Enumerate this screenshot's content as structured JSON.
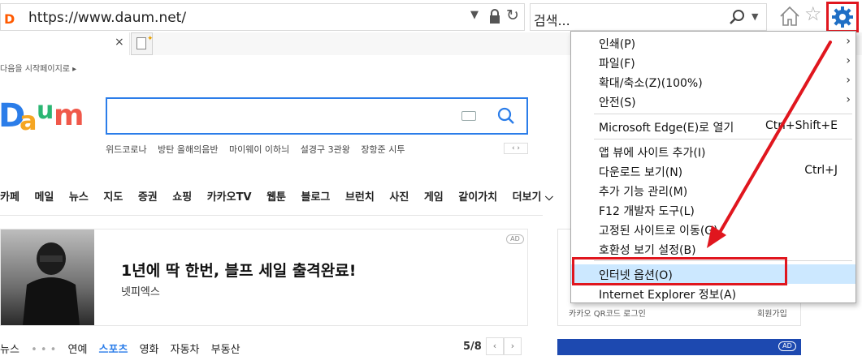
{
  "browser": {
    "url": "https://www.daum.net/",
    "search_placeholder": "검색...",
    "tab_close": "×"
  },
  "page": {
    "start_link": "다음을 시작페이지로 ▸",
    "trends": [
      "위드코로나",
      "방탄 올해의음반",
      "마이웨이 이하늬",
      "설경구 3관왕",
      "장항준 시투"
    ],
    "trend_nav": "‹ ›",
    "gnb": [
      "카페",
      "메일",
      "뉴스",
      "지도",
      "증권",
      "쇼핑",
      "카카오TV",
      "웹툰",
      "블로그",
      "브런치",
      "사진",
      "게임",
      "같이가치",
      "더보기 ⌵"
    ],
    "banner": {
      "title": "1년에 딱 한번, 블프 세일 출격완료!",
      "subtitle": "넷피엑스",
      "ad": "AD"
    },
    "news_tabs": [
      "뉴스",
      "연예",
      "스포츠",
      "영화",
      "자동차",
      "부동산"
    ],
    "news_dots": "• • •",
    "news_page": "5/8",
    "news_prev": "‹",
    "news_next": "›",
    "login_qr": "카카오 QR코드 로그인",
    "login_join": "회원가입",
    "right_ad": "AD"
  },
  "menu": {
    "items": [
      {
        "label": "인쇄(P)",
        "shortcut": "",
        "submenu": true
      },
      {
        "label": "파일(F)",
        "shortcut": "",
        "submenu": true
      },
      {
        "label": "확대/축소(Z)(100%)",
        "shortcut": "",
        "submenu": true
      },
      {
        "label": "안전(S)",
        "shortcut": "",
        "submenu": true
      },
      {
        "label": "Microsoft Edge(E)로 열기",
        "shortcut": "Ctrl+Shift+E",
        "submenu": false
      },
      {
        "label": "앱 뷰에 사이트 추가(I)",
        "shortcut": "",
        "submenu": false
      },
      {
        "label": "다운로드 보기(N)",
        "shortcut": "Ctrl+J",
        "submenu": false
      },
      {
        "label": "추가 기능 관리(M)",
        "shortcut": "",
        "submenu": false
      },
      {
        "label": "F12 개발자 도구(L)",
        "shortcut": "",
        "submenu": false
      },
      {
        "label": "고정된 사이트로 이동(G)",
        "shortcut": "",
        "submenu": false
      },
      {
        "label": "호환성 보기 설정(B)",
        "shortcut": "",
        "submenu": false
      },
      {
        "label": "인터넷 옵션(O)",
        "shortcut": "",
        "submenu": false,
        "highlighted": true
      },
      {
        "label": "Internet Explorer 정보(A)",
        "shortcut": "",
        "submenu": false
      }
    ],
    "arrow_glyph": "›"
  },
  "colors": {
    "annotation_red": "#e0161e",
    "highlight": "#cce8ff",
    "accent_blue": "#2b7de9"
  }
}
